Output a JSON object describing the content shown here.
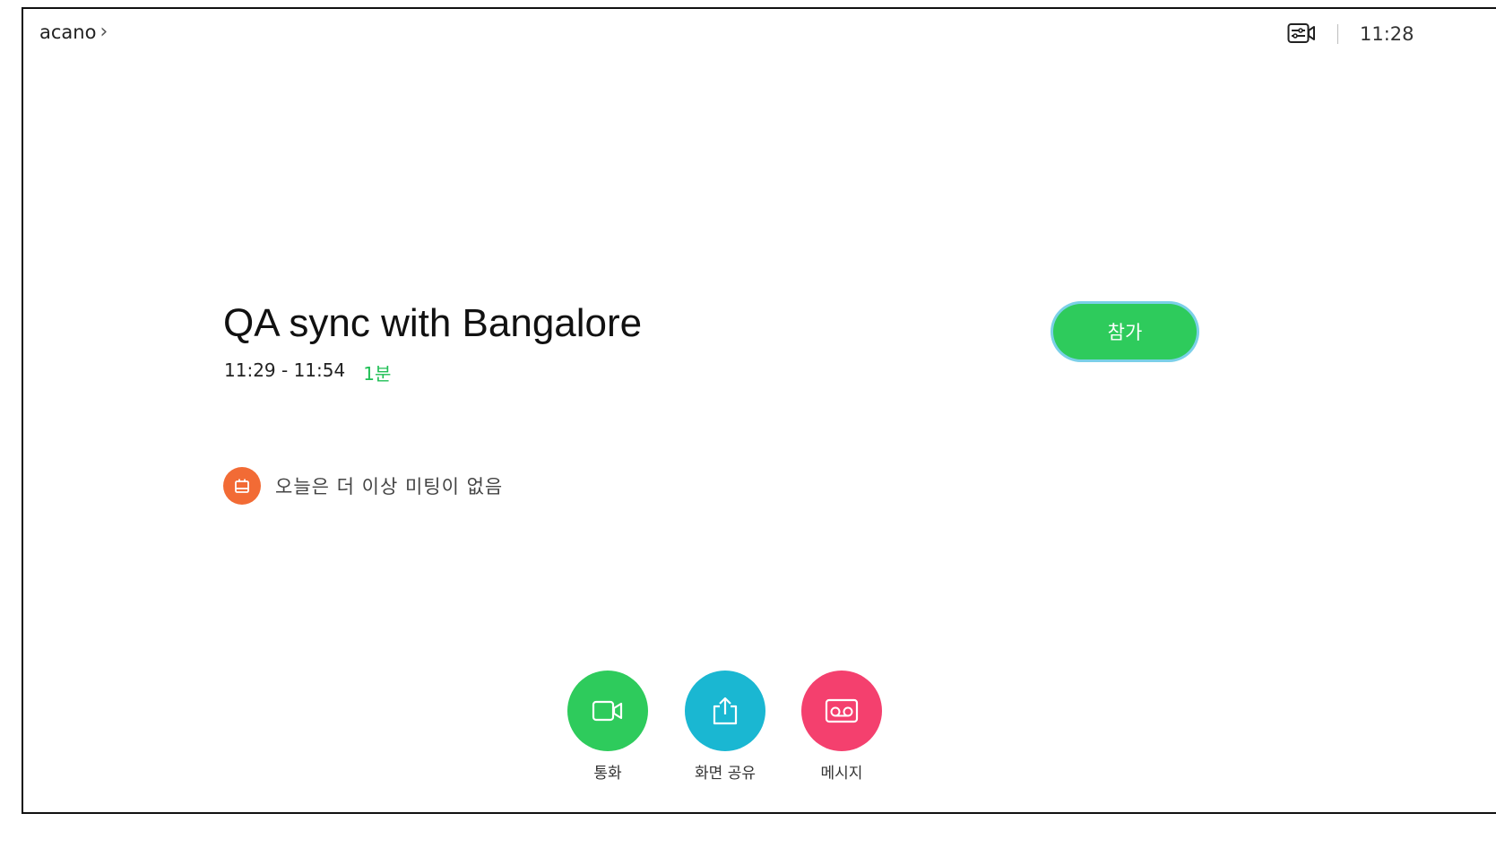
{
  "header": {
    "device_name": "acano",
    "time": "11:28"
  },
  "meeting": {
    "title": "QA sync with Bangalore",
    "time_range": "11:29 - 11:54",
    "starts_in": "1분",
    "join_label": "참가"
  },
  "notice": {
    "text": "오늘은 더 이상 미팅이 없음"
  },
  "actions": {
    "call_label": "통화",
    "share_label": "화면 공유",
    "message_label": "메시지"
  },
  "colors": {
    "join": "#2ecb5c",
    "call": "#2ecb5c",
    "share": "#1ab7d2",
    "message": "#f4406e",
    "notice": "#f26b35",
    "starts_in": "#1fbf55"
  },
  "icons": {
    "header": [
      "video-settings-icon"
    ],
    "notice": "calendar-icon",
    "call": "video-camera-icon",
    "share": "share-upload-icon",
    "message": "voicemail-icon"
  }
}
